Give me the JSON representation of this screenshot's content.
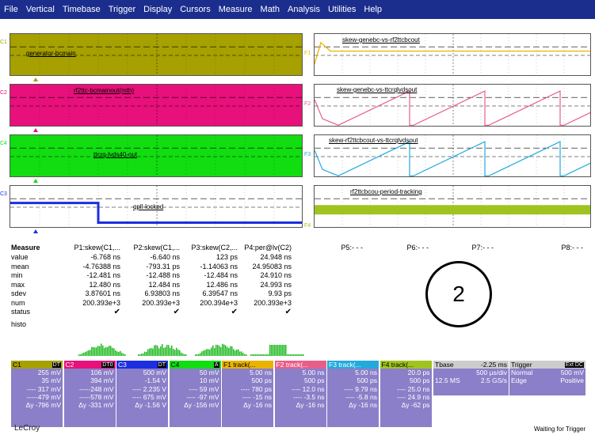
{
  "menu": [
    "File",
    "Vertical",
    "Timebase",
    "Trigger",
    "Display",
    "Cursors",
    "Measure",
    "Math",
    "Analysis",
    "Utilities",
    "Help"
  ],
  "traces_left": [
    {
      "tag": "C1",
      "label": "generator-bcmain",
      "color": "#a6a000",
      "bg": "#a6a000"
    },
    {
      "tag": "C2",
      "label": "rf2ttc-bcmainout(mth)",
      "color": "#e8107a",
      "bg": "#e8107a"
    },
    {
      "tag": "C4",
      "label": "ttcrq-lvds40-out",
      "color": "#11dd11",
      "bg": "#11dd11"
    },
    {
      "tag": "C3",
      "label": "qpll-locked",
      "color": "#1b2ee0",
      "bg": "#ffffff"
    }
  ],
  "traces_right": [
    {
      "tag": "F1",
      "label": "skew-genebc-vs-rf2ttcbcout",
      "color": "#e8b400"
    },
    {
      "tag": "F2",
      "label": "skew-genebc-vs-ttcrqlvdsout",
      "color": "#e85e8a"
    },
    {
      "tag": "F3",
      "label": "skew-rf2ttcbcout-vs-ttcrqlvdsout",
      "color": "#22aadd"
    },
    {
      "tag": "F4",
      "label": "rf2ttcbcou-period-tracking",
      "color": "#9fc41f"
    }
  ],
  "measure": {
    "title": "Measure",
    "headers": [
      "P1:skew(C1,...",
      "P2:skew(C1,...",
      "P3:skew(C2,...",
      "P4:per@lv(C2)",
      "P5:- - -",
      "P6:- - -",
      "P7:- - -",
      "P8:- - -"
    ],
    "rows": [
      {
        "label": "value",
        "cells": [
          "-6.768 ns",
          "-6.640 ns",
          "123 ps",
          "24.948 ns"
        ]
      },
      {
        "label": "mean",
        "cells": [
          "-4.76388 ns",
          "-793.31 ps",
          "-1.14063 ns",
          "24.95083 ns"
        ]
      },
      {
        "label": "min",
        "cells": [
          "-12.481 ns",
          "-12.488 ns",
          "-12.484 ns",
          "24.910 ns"
        ]
      },
      {
        "label": "max",
        "cells": [
          "12.480 ns",
          "12.484 ns",
          "12.486 ns",
          "24.993 ns"
        ]
      },
      {
        "label": "sdev",
        "cells": [
          "3.87601 ns",
          "6.93803 ns",
          "6.39547 ns",
          "9.93 ps"
        ]
      },
      {
        "label": "num",
        "cells": [
          "200.393e+3",
          "200.393e+3",
          "200.394e+3",
          "200.393e+3"
        ]
      },
      {
        "label": "status",
        "cells": [
          "✔",
          "✔",
          "✔",
          "✔"
        ]
      },
      {
        "label": "histo",
        "cells": [
          "",
          "",
          "",
          ""
        ]
      }
    ]
  },
  "annotation": "2",
  "boxes": [
    {
      "name": "C1",
      "badge": "DT",
      "color": "#8a7fc8",
      "lines": [
        "255 mV",
        "35 mV",
        "---- 317 mV",
        "-----479 mV",
        "Δy -796 mV"
      ]
    },
    {
      "name": "C2",
      "badge": "DT0",
      "color": "#8a7fc8",
      "lines": [
        "106 mV",
        "394 mV",
        "-----248 mV",
        "-----578 mV",
        "Δy -331 mV"
      ]
    },
    {
      "name": "C3",
      "badge": "DT",
      "color": "#8a7fc8",
      "lines": [
        "500 mV",
        "-1.54 V",
        "---- 2.235 V",
        "---- 675 mV",
        "Δy -1.56 V"
      ]
    },
    {
      "name": "C4",
      "badge": "A",
      "color": "#8a7fc8",
      "lines": [
        "50 mV",
        "10 mV",
        "---- 59 mV",
        "---- -97 mV",
        "Δy -156 mV"
      ]
    },
    {
      "name": "F1  track(...",
      "badge": "",
      "color": "#8a7fc8",
      "lines": [
        "5.00 ns",
        "500 ps",
        "---- 780 ps",
        "---- -15 ns",
        "Δy -16 ns"
      ]
    },
    {
      "name": "F2  track(...",
      "badge": "",
      "color": "#8a7fc8",
      "lines": [
        "5.00 ns",
        "500 ps",
        "---- 12.0 ns",
        "---- -3.5 ns",
        "Δy -16 ns"
      ]
    },
    {
      "name": "F3  track(...",
      "badge": "",
      "color": "#8a7fc8",
      "lines": [
        "5.00 ns",
        "500 ps",
        "---- 9.79 ns",
        "---- -5.8 ns",
        "Δy -16 ns"
      ]
    },
    {
      "name": "F4  track(...",
      "badge": "",
      "color": "#8a7fc8",
      "lines": [
        "20.0 ps",
        "500 ps",
        "---- 25.0 ns",
        "---- 24.9 ns",
        "Δy -62 ps"
      ]
    }
  ],
  "timebase": {
    "label": "Tbase",
    "offset": "-2.25 ms",
    "div": "500 µs/div",
    "samples": "12.5 MS",
    "rate": "2.5 GS/s"
  },
  "trigger": {
    "label": "Trigger",
    "badge": "Ext DC",
    "mode": "Normal",
    "level": "500 mV",
    "type": "Edge",
    "slope": "Positive"
  },
  "status": "Waiting for Trigger",
  "brand": "LeCroy"
}
